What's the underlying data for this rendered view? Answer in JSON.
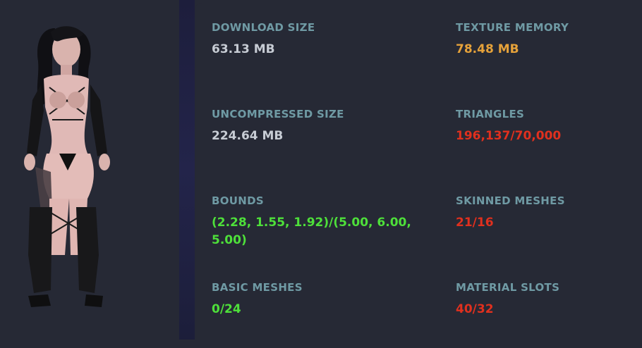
{
  "colors": {
    "label": "#6f9aa4",
    "neutral": "#c7ccd4",
    "warning": "#e6a23a",
    "bad": "#e0301e",
    "good": "#4ee03a"
  },
  "preview": {
    "icon": "avatar-model-preview"
  },
  "stats": [
    {
      "id": "download-size",
      "label": "DOWNLOAD SIZE",
      "value": "63.13 MB",
      "status": "neutral"
    },
    {
      "id": "texture-memory",
      "label": "TEXTURE MEMORY",
      "value": "78.48 MB",
      "status": "warning"
    },
    {
      "id": "uncompressed-size",
      "label": "UNCOMPRESSED SIZE",
      "value": "224.64 MB",
      "status": "neutral"
    },
    {
      "id": "triangles",
      "label": "TRIANGLES",
      "value": "196,137/70,000",
      "status": "bad"
    },
    {
      "id": "bounds",
      "label": "BOUNDS",
      "value": "(2.28, 1.55, 1.92)/(5.00, 6.00, 5.00)",
      "status": "good"
    },
    {
      "id": "skinned-meshes",
      "label": "SKINNED MESHES",
      "value": "21/16",
      "status": "bad"
    },
    {
      "id": "basic-meshes",
      "label": "BASIC MESHES",
      "value": "0/24",
      "status": "good"
    },
    {
      "id": "material-slots",
      "label": "MATERIAL SLOTS",
      "value": "40/32",
      "status": "bad"
    }
  ]
}
